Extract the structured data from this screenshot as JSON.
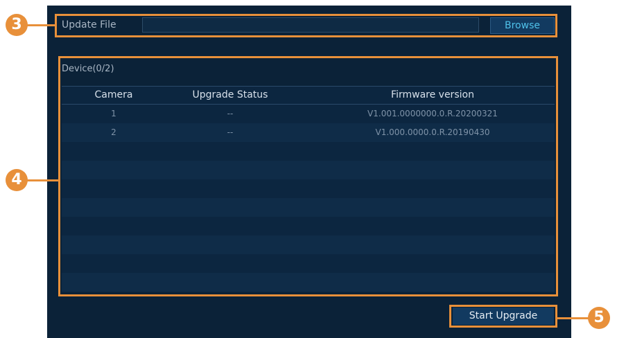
{
  "update_file": {
    "label": "Update File",
    "value": "",
    "browse_label": "Browse"
  },
  "device": {
    "label": "Device(0/2)",
    "columns": [
      "Camera",
      "Upgrade Status",
      "Firmware version"
    ],
    "rows": [
      {
        "camera": "1",
        "status": "--",
        "firmware": "V1.001.0000000.0.R.20200321"
      },
      {
        "camera": "2",
        "status": "--",
        "firmware": "V1.000.0000.0.R.20190430"
      }
    ],
    "empty_rows": 8
  },
  "actions": {
    "start_upgrade_label": "Start Upgrade"
  },
  "callouts": {
    "update": "3",
    "device": "4",
    "start": "5"
  },
  "colors": {
    "panel_bg": "#0b2238",
    "annotation": "#e8903a",
    "button_bg": "#123a60",
    "browse_text": "#4fc1ea"
  }
}
